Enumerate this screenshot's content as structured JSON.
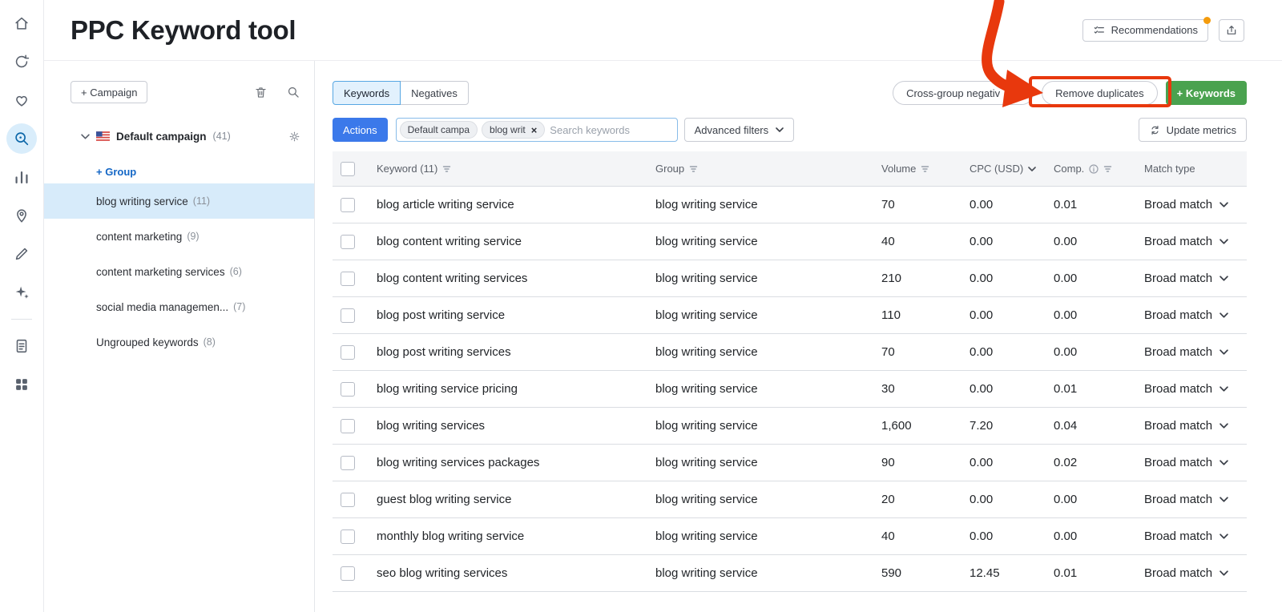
{
  "colors": {
    "accent_blue": "#3b79ea",
    "tab_selected_bg": "#e2f1fd",
    "brand_green": "#4aa24f",
    "annotation_red": "#e8380d",
    "notification_orange": "#f49b0c",
    "selected_group_bg": "#d7ebfa"
  },
  "icons": {
    "close": "×"
  },
  "sidebar": {
    "icons": [
      "home-icon",
      "projects-sync-icon",
      "feedback-heart-icon",
      "keyword-tool-target-icon",
      "analytics-bars-icon",
      "map-pin-icon",
      "writing-pencil-icon",
      "ai-sparkles-icon",
      "reports-document-icon",
      "apps-grid-icon"
    ],
    "active_icon": "keyword-tool-target-icon"
  },
  "header": {
    "title": "PPC Keyword tool",
    "recommendations": "Recommendations"
  },
  "campaign_panel": {
    "add_campaign": "+ Campaign",
    "campaign": {
      "name": "Default campaign",
      "count": "(41)"
    },
    "add_group": "+ Group",
    "groups": [
      {
        "label": "blog writing service",
        "count": "(11)",
        "selected": true
      },
      {
        "label": "content marketing",
        "count": "(9)"
      },
      {
        "label": "content marketing services",
        "count": "(6)"
      },
      {
        "label": "social media managemen...",
        "count": "(7)"
      },
      {
        "label": "Ungrouped keywords",
        "count": "(8)"
      }
    ]
  },
  "toolbar": {
    "tabs": [
      {
        "label": "Keywords",
        "selected": true
      },
      {
        "label": "Negatives"
      }
    ],
    "cross_group_negatives": "Cross-group negativ",
    "remove_duplicates": "Remove duplicates",
    "add_keywords": "+ Keywords",
    "actions": "Actions",
    "filter_chips": [
      {
        "label": "Default campa"
      },
      {
        "label": "blog writ",
        "removable": true
      }
    ],
    "search_placeholder": "Search keywords",
    "advanced_filters": "Advanced filters",
    "update_metrics": "Update metrics"
  },
  "table": {
    "columns": {
      "keyword": "Keyword (11)",
      "group": "Group",
      "volume": "Volume",
      "cpc": "CPC (USD)",
      "comp": "Comp.",
      "match": "Match type"
    },
    "rows": [
      {
        "keyword": "blog article writing service",
        "group": "blog writing service",
        "volume": "70",
        "cpc": "0.00",
        "comp": "0.01",
        "match": "Broad match"
      },
      {
        "keyword": "blog content writing service",
        "group": "blog writing service",
        "volume": "40",
        "cpc": "0.00",
        "comp": "0.00",
        "match": "Broad match"
      },
      {
        "keyword": "blog content writing services",
        "group": "blog writing service",
        "volume": "210",
        "cpc": "0.00",
        "comp": "0.00",
        "match": "Broad match"
      },
      {
        "keyword": "blog post writing service",
        "group": "blog writing service",
        "volume": "110",
        "cpc": "0.00",
        "comp": "0.00",
        "match": "Broad match"
      },
      {
        "keyword": "blog post writing services",
        "group": "blog writing service",
        "volume": "70",
        "cpc": "0.00",
        "comp": "0.00",
        "match": "Broad match"
      },
      {
        "keyword": "blog writing service pricing",
        "group": "blog writing service",
        "volume": "30",
        "cpc": "0.00",
        "comp": "0.01",
        "match": "Broad match"
      },
      {
        "keyword": "blog writing services",
        "group": "blog writing service",
        "volume": "1,600",
        "cpc": "7.20",
        "comp": "0.04",
        "match": "Broad match"
      },
      {
        "keyword": "blog writing services packages",
        "group": "blog writing service",
        "volume": "90",
        "cpc": "0.00",
        "comp": "0.02",
        "match": "Broad match"
      },
      {
        "keyword": "guest blog writing service",
        "group": "blog writing service",
        "volume": "20",
        "cpc": "0.00",
        "comp": "0.00",
        "match": "Broad match"
      },
      {
        "keyword": "monthly blog writing service",
        "group": "blog writing service",
        "volume": "40",
        "cpc": "0.00",
        "comp": "0.00",
        "match": "Broad match"
      },
      {
        "keyword": "seo blog writing services",
        "group": "blog writing service",
        "volume": "590",
        "cpc": "12.45",
        "comp": "0.01",
        "match": "Broad match"
      }
    ]
  }
}
